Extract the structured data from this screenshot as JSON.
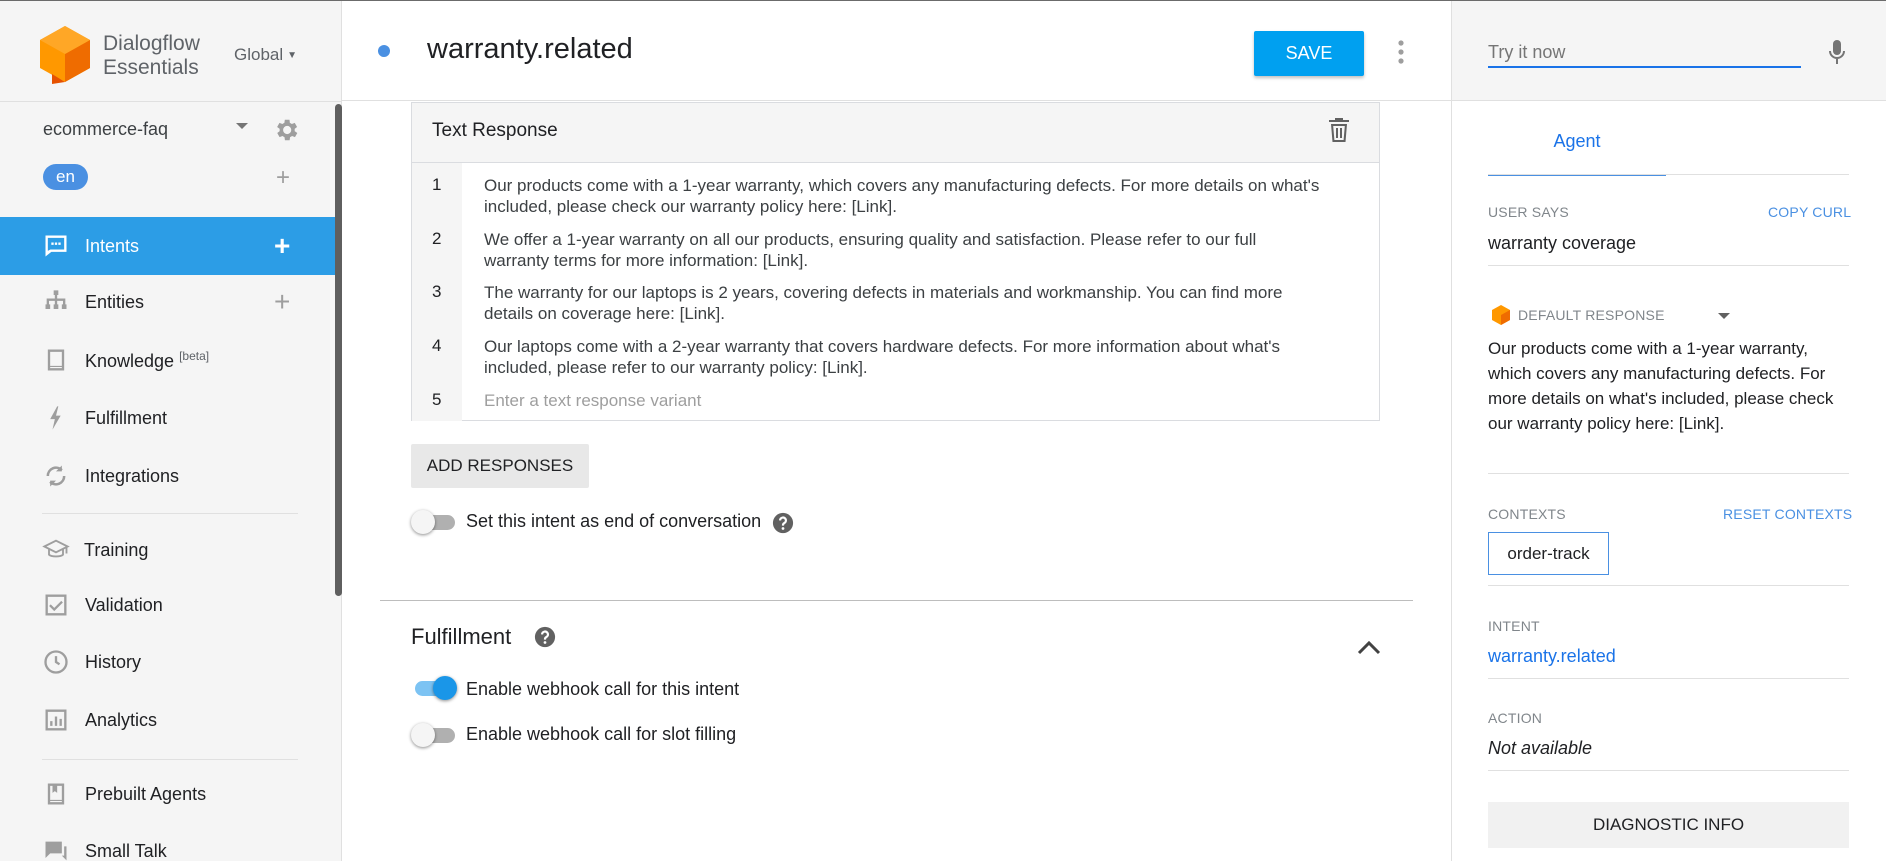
{
  "sidebar": {
    "brand_name": "Dialogflow\nEssentials",
    "region": "Global",
    "agent_name": "ecommerce-faq",
    "language": "en",
    "items": [
      {
        "label": "Intents",
        "icon": "chat-bubble-icon"
      },
      {
        "label": "Entities",
        "icon": "hierarchy-icon"
      },
      {
        "label": "Knowledge",
        "badge": "[beta]",
        "icon": "book-icon"
      },
      {
        "label": "Fulfillment",
        "icon": "lightning-icon"
      },
      {
        "label": "Integrations",
        "icon": "refresh-icon"
      },
      {
        "label": "Training",
        "icon": "graduation-cap-icon"
      },
      {
        "label": "Validation",
        "icon": "checkbox-icon"
      },
      {
        "label": "History",
        "icon": "clock-icon"
      },
      {
        "label": "Analytics",
        "icon": "bar-chart-icon"
      },
      {
        "label": "Prebuilt Agents",
        "icon": "bookmark-book-icon"
      },
      {
        "label": "Small Talk",
        "icon": "chat-icon"
      }
    ]
  },
  "header": {
    "intent_title": "warranty.related",
    "save_label": "SAVE"
  },
  "text_response": {
    "title": "Text Response",
    "rows": [
      {
        "num": "1",
        "text": "Our products come with a 1-year warranty, which covers any manufacturing defects. For more details on what's included, please check our warranty policy here: [Link]."
      },
      {
        "num": "2",
        "text": "We offer a 1-year warranty on all our products, ensuring quality and satisfaction. Please refer to our full warranty terms for more information: [Link]."
      },
      {
        "num": "3",
        "text": "The warranty for our laptops is 2 years, covering defects in materials and workmanship. You can find more details on coverage here: [Link]."
      },
      {
        "num": "4",
        "text": "Our laptops come with a 2-year warranty that covers hardware defects. For more information about what's included, please refer to our warranty policy: [Link]."
      },
      {
        "num": "5",
        "placeholder": "Enter a text response variant"
      }
    ],
    "add_responses_label": "ADD RESPONSES",
    "end_conversation_label": "Set this intent as end of conversation",
    "end_conversation_on": false
  },
  "fulfillment": {
    "title": "Fulfillment",
    "webhook_label": "Enable webhook call for this intent",
    "webhook_on": true,
    "slot_label": "Enable webhook call for slot filling",
    "slot_on": false
  },
  "right_panel": {
    "try_placeholder": "Try it now",
    "tab_label": "Agent",
    "user_says_caption": "USER SAYS",
    "copy_curl_label": "COPY CURL",
    "user_says_value": "warranty coverage",
    "default_response_caption": "DEFAULT RESPONSE",
    "default_response_text": "Our products come with a 1-year warranty, which covers any manufacturing defects. For more details on what's included, please check our warranty policy here: [Link].",
    "contexts_caption": "CONTEXTS",
    "reset_contexts_label": "RESET CONTEXTS",
    "context_chip": "order-track",
    "intent_caption": "INTENT",
    "intent_value": "warranty.related",
    "action_caption": "ACTION",
    "action_value": "Not available",
    "diagnostic_label": "DIAGNOSTIC INFO"
  },
  "colors": {
    "accent": "#2c9de6",
    "save_button": "#00a0f0",
    "link": "#1a73e8",
    "logo_orange": "#ef8a17"
  }
}
